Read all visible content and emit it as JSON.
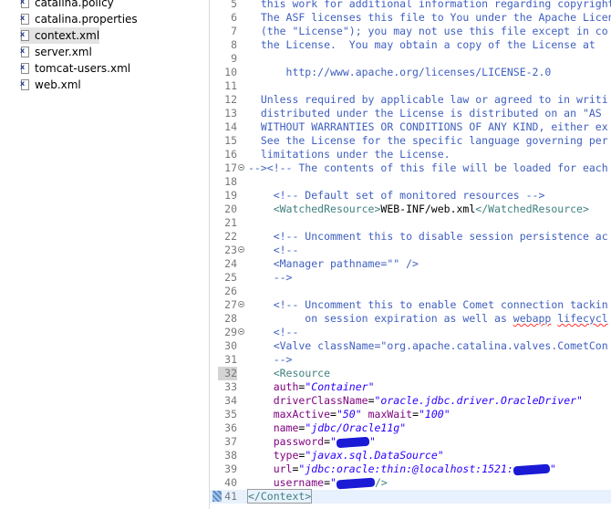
{
  "explorer": {
    "files": [
      {
        "label": "catalina.policy",
        "icon": "xml-file-icon"
      },
      {
        "label": "catalina.properties",
        "icon": "properties-file-icon"
      },
      {
        "label": "context.xml",
        "icon": "xml-file-icon",
        "selected": true
      },
      {
        "label": "server.xml",
        "icon": "xml-file-icon"
      },
      {
        "label": "tomcat-users.xml",
        "icon": "xml-file-icon"
      },
      {
        "label": "web.xml",
        "icon": "xml-file-icon"
      }
    ]
  },
  "editor": {
    "lines": [
      {
        "num": "5",
        "segments": [
          {
            "t": "cmt",
            "v": "  this work for additional information regarding copyright"
          }
        ]
      },
      {
        "num": "6",
        "segments": [
          {
            "t": "cmt",
            "v": "  The ASF licenses this file to You under the Apache License"
          }
        ]
      },
      {
        "num": "7",
        "segments": [
          {
            "t": "cmt",
            "v": "  (the \"License\"); you may not use this file except in co"
          }
        ]
      },
      {
        "num": "8",
        "segments": [
          {
            "t": "cmt",
            "v": "  the License.  You may obtain a copy of the License at"
          }
        ]
      },
      {
        "num": "9",
        "segments": []
      },
      {
        "num": "10",
        "segments": [
          {
            "t": "cmt",
            "v": "      http://www.apache.org/licenses/LICENSE-2.0"
          }
        ]
      },
      {
        "num": "11",
        "segments": []
      },
      {
        "num": "12",
        "segments": [
          {
            "t": "cmt",
            "v": "  Unless required by applicable law or agreed to in writi"
          }
        ]
      },
      {
        "num": "13",
        "segments": [
          {
            "t": "cmt",
            "v": "  distributed under the License is distributed on an \"AS "
          }
        ]
      },
      {
        "num": "14",
        "segments": [
          {
            "t": "cmt",
            "v": "  WITHOUT WARRANTIES OR CONDITIONS OF ANY KIND, either ex"
          }
        ]
      },
      {
        "num": "15",
        "segments": [
          {
            "t": "cmt",
            "v": "  See the License for the specific language governing per"
          }
        ]
      },
      {
        "num": "16",
        "segments": [
          {
            "t": "cmt",
            "v": "  limitations under the License."
          }
        ]
      },
      {
        "num": "17",
        "fold": true,
        "segments": [
          {
            "t": "cmt",
            "v": "--><!-- The contents of this file will be loaded for each"
          }
        ]
      },
      {
        "num": "18",
        "segments": []
      },
      {
        "num": "19",
        "segments": [
          {
            "t": "cmt",
            "v": "    <!-- Default set of monitored resources -->"
          }
        ]
      },
      {
        "num": "20",
        "segments": [
          {
            "t": "txt",
            "v": "    "
          },
          {
            "t": "tag",
            "v": "<WatchedResource>"
          },
          {
            "t": "txt",
            "v": "WEB-INF/web.xml"
          },
          {
            "t": "tag",
            "v": "</WatchedResource>"
          }
        ]
      },
      {
        "num": "21",
        "segments": []
      },
      {
        "num": "22",
        "segments": [
          {
            "t": "cmt",
            "v": "    <!-- Uncomment this to disable session persistence ac"
          }
        ]
      },
      {
        "num": "23",
        "fold": true,
        "segments": [
          {
            "t": "cmt",
            "v": "    <!--"
          }
        ]
      },
      {
        "num": "24",
        "segments": [
          {
            "t": "cmt",
            "v": "    <Manager pathname=\"\" />"
          }
        ]
      },
      {
        "num": "25",
        "segments": [
          {
            "t": "cmt",
            "v": "    -->"
          }
        ]
      },
      {
        "num": "26",
        "segments": []
      },
      {
        "num": "27",
        "fold": true,
        "segments": [
          {
            "t": "cmt",
            "v": "    <!-- Uncomment this to enable Comet connection tackin"
          }
        ]
      },
      {
        "num": "28",
        "segments": [
          {
            "t": "cmt",
            "v": "         on session expiration as well as "
          },
          {
            "t": "cmt squiggle",
            "v": "webapp"
          },
          {
            "t": "cmt",
            "v": " "
          },
          {
            "t": "cmt squiggle",
            "v": "lifecycl"
          }
        ]
      },
      {
        "num": "29",
        "fold": true,
        "segments": [
          {
            "t": "cmt",
            "v": "    <!--"
          }
        ]
      },
      {
        "num": "30",
        "segments": [
          {
            "t": "cmt",
            "v": "    <Valve className=\"org.apache.catalina.valves.CometCon"
          }
        ]
      },
      {
        "num": "31",
        "segments": [
          {
            "t": "cmt",
            "v": "    -->"
          }
        ]
      },
      {
        "num": "32",
        "segments": [
          {
            "t": "txt",
            "v": "    "
          },
          {
            "t": "tag",
            "v": "<Resource"
          }
        ]
      },
      {
        "num": "33",
        "segments": [
          {
            "t": "txt",
            "v": "    "
          },
          {
            "t": "attr",
            "v": "auth"
          },
          {
            "t": "txt",
            "v": "="
          },
          {
            "t": "val",
            "v": "\"Container\""
          }
        ]
      },
      {
        "num": "34",
        "segments": [
          {
            "t": "txt",
            "v": "    "
          },
          {
            "t": "attr",
            "v": "driverClassName"
          },
          {
            "t": "txt",
            "v": "="
          },
          {
            "t": "val",
            "v": "\"oracle.jdbc.driver.OracleDriver\""
          }
        ]
      },
      {
        "num": "35",
        "segments": [
          {
            "t": "txt",
            "v": "    "
          },
          {
            "t": "attr",
            "v": "maxActive"
          },
          {
            "t": "txt",
            "v": "="
          },
          {
            "t": "val",
            "v": "\"50\""
          },
          {
            "t": "txt",
            "v": " "
          },
          {
            "t": "attr",
            "v": "maxWait"
          },
          {
            "t": "txt",
            "v": "="
          },
          {
            "t": "val",
            "v": "\"100\""
          }
        ]
      },
      {
        "num": "36",
        "segments": [
          {
            "t": "txt",
            "v": "    "
          },
          {
            "t": "attr",
            "v": "name"
          },
          {
            "t": "txt",
            "v": "="
          },
          {
            "t": "val",
            "v": "\"jdbc/Oracle11g\""
          }
        ]
      },
      {
        "num": "37",
        "segments": [
          {
            "t": "txt",
            "v": "    "
          },
          {
            "t": "attr",
            "v": "password"
          },
          {
            "t": "txt",
            "v": "="
          },
          {
            "t": "val",
            "v": "\""
          },
          {
            "t": "redact",
            "v": "36"
          },
          {
            "t": "val",
            "v": "\""
          }
        ]
      },
      {
        "num": "38",
        "segments": [
          {
            "t": "txt",
            "v": "    "
          },
          {
            "t": "attr",
            "v": "type"
          },
          {
            "t": "txt",
            "v": "="
          },
          {
            "t": "val",
            "v": "\"javax.sql.DataSource\""
          }
        ]
      },
      {
        "num": "39",
        "segments": [
          {
            "t": "txt",
            "v": "    "
          },
          {
            "t": "attr",
            "v": "url"
          },
          {
            "t": "txt",
            "v": "="
          },
          {
            "t": "val",
            "v": "\"jdbc:oracle:thin:@localhost:1521:"
          },
          {
            "t": "redact",
            "v": "40"
          },
          {
            "t": "val",
            "v": "\""
          }
        ]
      },
      {
        "num": "40",
        "segments": [
          {
            "t": "txt",
            "v": "    "
          },
          {
            "t": "attr",
            "v": "username"
          },
          {
            "t": "txt",
            "v": "="
          },
          {
            "t": "val",
            "v": "\""
          },
          {
            "t": "redact",
            "v": "42"
          },
          {
            "t": "tag",
            "v": "/>"
          }
        ]
      },
      {
        "num": "41",
        "current": true,
        "segments": [
          {
            "t": "tag",
            "v": "</Context>"
          }
        ]
      }
    ]
  },
  "colors": {
    "comment": "#3f5fbf",
    "tag": "#3f7f7f",
    "attribute": "#7f007f",
    "value": "#2a00ff",
    "redaction": "#1b1bd6"
  }
}
